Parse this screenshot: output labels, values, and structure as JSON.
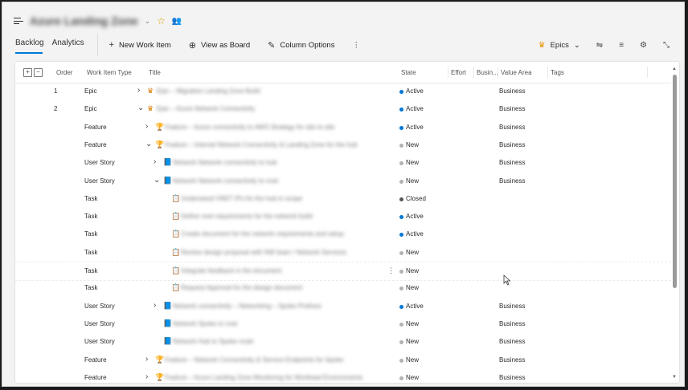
{
  "header": {
    "title": "Azure Landing Zone",
    "icons": [
      "menu-icon",
      "chevron-down-icon",
      "star-icon",
      "people-icon"
    ]
  },
  "tabs": [
    {
      "label": "Backlog",
      "active": true
    },
    {
      "label": "Analytics",
      "active": false
    }
  ],
  "commands": {
    "new_work_item": "New Work Item",
    "view_as_board": "View as Board",
    "column_options": "Column Options",
    "more": "⋮"
  },
  "right_commands": {
    "level": "Epics",
    "icons": [
      "settings-sliders-icon",
      "filter-icon",
      "gear-icon",
      "collapse-icon"
    ]
  },
  "columns": {
    "order": "Order",
    "work_item_type": "Work Item Type",
    "title": "Title",
    "state": "State",
    "effort": "Effort",
    "business": "Busin...",
    "value_area": "Value Area",
    "tags": "Tags"
  },
  "state_colors": {
    "Active": "#0078d4",
    "New": "#b2b2b2",
    "Closed": "#555555"
  },
  "rows": [
    {
      "order": "1",
      "type": "Epic",
      "state": "Active",
      "value_area": "Business",
      "title": "Epic – Migration Landing Zone Build"
    },
    {
      "order": "2",
      "type": "Epic",
      "state": "Active",
      "value_area": "Business",
      "title": "Epic – Azure Network Connectivity"
    },
    {
      "order": "",
      "type": "Feature",
      "state": "Active",
      "value_area": "Business",
      "title": "Feature – Azure connectivity to AWS Strategy for site to site"
    },
    {
      "order": "",
      "type": "Feature",
      "state": "New",
      "value_area": "Business",
      "title": "Feature – Internal Network Connectivity & Landing Zone for the hub"
    },
    {
      "order": "",
      "type": "User Story",
      "state": "New",
      "value_area": "Business",
      "title": "Network Network connectivity to hub"
    },
    {
      "order": "",
      "type": "User Story",
      "state": "New",
      "value_area": "Business",
      "title": "Network Network connectivity to vnet"
    },
    {
      "order": "",
      "type": "Task",
      "state": "Closed",
      "value_area": "",
      "title": "Understand VNET IPs for the hub in scope"
    },
    {
      "order": "",
      "type": "Task",
      "state": "Active",
      "value_area": "",
      "title": "Define vnet requirements for the network build"
    },
    {
      "order": "",
      "type": "Task",
      "state": "Active",
      "value_area": "",
      "title": "Create document for the network requirements and setup"
    },
    {
      "order": "",
      "type": "Task",
      "state": "New",
      "value_area": "",
      "title": "Review design proposal with NW team / Network Services"
    },
    {
      "order": "",
      "type": "Task",
      "state": "New",
      "value_area": "",
      "title": "Integrate feedback in the document"
    },
    {
      "order": "",
      "type": "Task",
      "state": "New",
      "value_area": "",
      "title": "Request Approval for the design document"
    },
    {
      "order": "",
      "type": "User Story",
      "state": "Active",
      "value_area": "Business",
      "title": "Network connectivity – Networking – Spoke Prefixes"
    },
    {
      "order": "",
      "type": "User Story",
      "state": "New",
      "value_area": "Business",
      "title": "Network Spoke to vnet"
    },
    {
      "order": "",
      "type": "User Story",
      "state": "New",
      "value_area": "Business",
      "title": "Network Hub to Spoke route"
    },
    {
      "order": "",
      "type": "Feature",
      "state": "New",
      "value_area": "Business",
      "title": "Feature – Network Connectivity & Service Endpoints for Spoke"
    },
    {
      "order": "",
      "type": "Feature",
      "state": "New",
      "value_area": "Business",
      "title": "Feature – Azure Landing Zone Monitoring for Workload Environments"
    }
  ]
}
